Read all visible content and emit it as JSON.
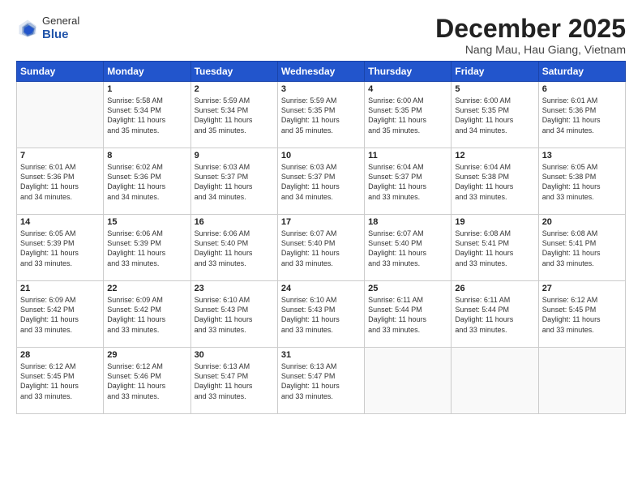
{
  "logo": {
    "general": "General",
    "blue": "Blue"
  },
  "title": "December 2025",
  "subtitle": "Nang Mau, Hau Giang, Vietnam",
  "header": {
    "days": [
      "Sunday",
      "Monday",
      "Tuesday",
      "Wednesday",
      "Thursday",
      "Friday",
      "Saturday"
    ]
  },
  "weeks": [
    [
      {
        "day": "",
        "info": ""
      },
      {
        "day": "1",
        "info": "Sunrise: 5:58 AM\nSunset: 5:34 PM\nDaylight: 11 hours\nand 35 minutes."
      },
      {
        "day": "2",
        "info": "Sunrise: 5:59 AM\nSunset: 5:34 PM\nDaylight: 11 hours\nand 35 minutes."
      },
      {
        "day": "3",
        "info": "Sunrise: 5:59 AM\nSunset: 5:35 PM\nDaylight: 11 hours\nand 35 minutes."
      },
      {
        "day": "4",
        "info": "Sunrise: 6:00 AM\nSunset: 5:35 PM\nDaylight: 11 hours\nand 35 minutes."
      },
      {
        "day": "5",
        "info": "Sunrise: 6:00 AM\nSunset: 5:35 PM\nDaylight: 11 hours\nand 34 minutes."
      },
      {
        "day": "6",
        "info": "Sunrise: 6:01 AM\nSunset: 5:36 PM\nDaylight: 11 hours\nand 34 minutes."
      }
    ],
    [
      {
        "day": "7",
        "info": "Sunrise: 6:01 AM\nSunset: 5:36 PM\nDaylight: 11 hours\nand 34 minutes."
      },
      {
        "day": "8",
        "info": "Sunrise: 6:02 AM\nSunset: 5:36 PM\nDaylight: 11 hours\nand 34 minutes."
      },
      {
        "day": "9",
        "info": "Sunrise: 6:03 AM\nSunset: 5:37 PM\nDaylight: 11 hours\nand 34 minutes."
      },
      {
        "day": "10",
        "info": "Sunrise: 6:03 AM\nSunset: 5:37 PM\nDaylight: 11 hours\nand 34 minutes."
      },
      {
        "day": "11",
        "info": "Sunrise: 6:04 AM\nSunset: 5:37 PM\nDaylight: 11 hours\nand 33 minutes."
      },
      {
        "day": "12",
        "info": "Sunrise: 6:04 AM\nSunset: 5:38 PM\nDaylight: 11 hours\nand 33 minutes."
      },
      {
        "day": "13",
        "info": "Sunrise: 6:05 AM\nSunset: 5:38 PM\nDaylight: 11 hours\nand 33 minutes."
      }
    ],
    [
      {
        "day": "14",
        "info": "Sunrise: 6:05 AM\nSunset: 5:39 PM\nDaylight: 11 hours\nand 33 minutes."
      },
      {
        "day": "15",
        "info": "Sunrise: 6:06 AM\nSunset: 5:39 PM\nDaylight: 11 hours\nand 33 minutes."
      },
      {
        "day": "16",
        "info": "Sunrise: 6:06 AM\nSunset: 5:40 PM\nDaylight: 11 hours\nand 33 minutes."
      },
      {
        "day": "17",
        "info": "Sunrise: 6:07 AM\nSunset: 5:40 PM\nDaylight: 11 hours\nand 33 minutes."
      },
      {
        "day": "18",
        "info": "Sunrise: 6:07 AM\nSunset: 5:40 PM\nDaylight: 11 hours\nand 33 minutes."
      },
      {
        "day": "19",
        "info": "Sunrise: 6:08 AM\nSunset: 5:41 PM\nDaylight: 11 hours\nand 33 minutes."
      },
      {
        "day": "20",
        "info": "Sunrise: 6:08 AM\nSunset: 5:41 PM\nDaylight: 11 hours\nand 33 minutes."
      }
    ],
    [
      {
        "day": "21",
        "info": "Sunrise: 6:09 AM\nSunset: 5:42 PM\nDaylight: 11 hours\nand 33 minutes."
      },
      {
        "day": "22",
        "info": "Sunrise: 6:09 AM\nSunset: 5:42 PM\nDaylight: 11 hours\nand 33 minutes."
      },
      {
        "day": "23",
        "info": "Sunrise: 6:10 AM\nSunset: 5:43 PM\nDaylight: 11 hours\nand 33 minutes."
      },
      {
        "day": "24",
        "info": "Sunrise: 6:10 AM\nSunset: 5:43 PM\nDaylight: 11 hours\nand 33 minutes."
      },
      {
        "day": "25",
        "info": "Sunrise: 6:11 AM\nSunset: 5:44 PM\nDaylight: 11 hours\nand 33 minutes."
      },
      {
        "day": "26",
        "info": "Sunrise: 6:11 AM\nSunset: 5:44 PM\nDaylight: 11 hours\nand 33 minutes."
      },
      {
        "day": "27",
        "info": "Sunrise: 6:12 AM\nSunset: 5:45 PM\nDaylight: 11 hours\nand 33 minutes."
      }
    ],
    [
      {
        "day": "28",
        "info": "Sunrise: 6:12 AM\nSunset: 5:45 PM\nDaylight: 11 hours\nand 33 minutes."
      },
      {
        "day": "29",
        "info": "Sunrise: 6:12 AM\nSunset: 5:46 PM\nDaylight: 11 hours\nand 33 minutes."
      },
      {
        "day": "30",
        "info": "Sunrise: 6:13 AM\nSunset: 5:47 PM\nDaylight: 11 hours\nand 33 minutes."
      },
      {
        "day": "31",
        "info": "Sunrise: 6:13 AM\nSunset: 5:47 PM\nDaylight: 11 hours\nand 33 minutes."
      },
      {
        "day": "",
        "info": ""
      },
      {
        "day": "",
        "info": ""
      },
      {
        "day": "",
        "info": ""
      }
    ]
  ]
}
